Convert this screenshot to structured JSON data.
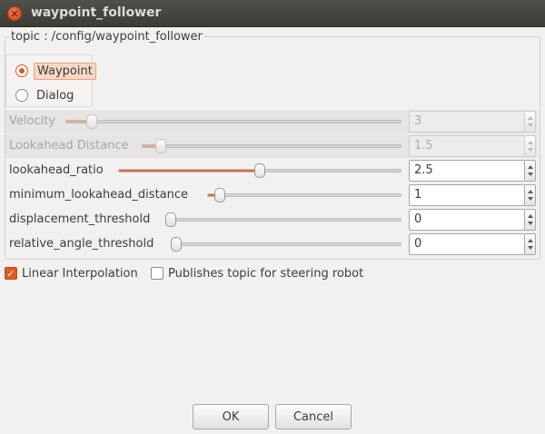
{
  "window": {
    "title": "waypoint_follower"
  },
  "group": {
    "label": "topic : /config/waypoint_follower"
  },
  "mode": {
    "options": [
      {
        "label": "Waypoint",
        "selected": true
      },
      {
        "label": "Dialog",
        "selected": false
      }
    ]
  },
  "params": [
    {
      "label": "Velocity",
      "value": "3",
      "enabled": false,
      "level_percent": 7
    },
    {
      "label": "Lookahead Distance",
      "value": "1.5",
      "enabled": false,
      "level_percent": 6
    },
    {
      "label": "lookahead_ratio",
      "value": "2.5",
      "enabled": true,
      "level_percent": 50
    },
    {
      "label": "minimum_lookahead_distance",
      "value": "1",
      "enabled": true,
      "level_percent": 5
    },
    {
      "label": "displacement_threshold",
      "value": "0",
      "enabled": true,
      "level_percent": 0
    },
    {
      "label": "relative_angle_threshold",
      "value": "0",
      "enabled": true,
      "level_percent": 0
    }
  ],
  "options": {
    "linear_interpolation": {
      "label": "Linear Interpolation",
      "checked": true
    },
    "publishes_topic": {
      "label": "Publishes topic for steering robot",
      "checked": false
    }
  },
  "buttons": {
    "ok": "OK",
    "cancel": "Cancel"
  },
  "colors": {
    "accent": "#e15a1f",
    "titlebar": "#3c3b37",
    "background": "#f2f1f0"
  }
}
